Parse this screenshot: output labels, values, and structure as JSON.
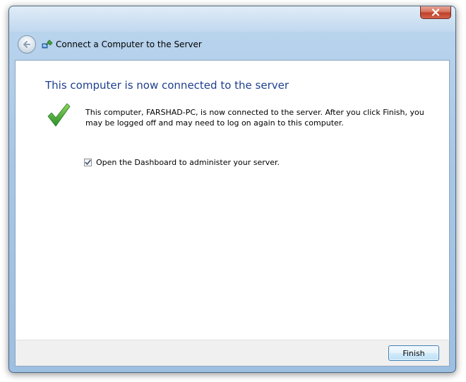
{
  "window": {
    "title": "Connect a Computer to the Server"
  },
  "page": {
    "heading": "This computer is now connected to the server",
    "message_line1": "This computer, FARSHAD-PC, is now connected to the server. After you click Finish, you",
    "message_line2": "may be logged off and may need to log on again to this computer.",
    "dashboard_option": {
      "label": "Open the Dashboard to administer your server.",
      "checked": true
    }
  },
  "footer": {
    "finish_label": "Finish"
  },
  "colors": {
    "heading": "#1e3f8f",
    "success_check": "#39a53a",
    "close_button": "#c0402a"
  },
  "icons": {
    "close": "close-icon",
    "back": "back-arrow-icon",
    "wizard": "connect-computer-icon",
    "success": "checkmark-icon"
  }
}
